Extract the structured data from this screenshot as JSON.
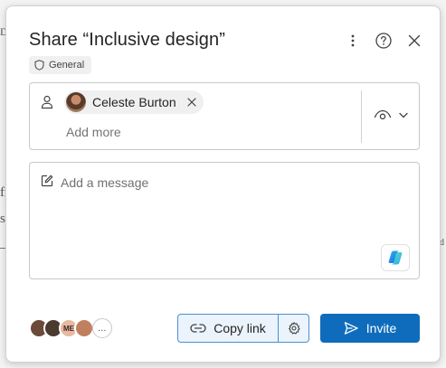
{
  "background": {
    "glyphs": [
      "D",
      "fi",
      "s",
      "d"
    ]
  },
  "dialog": {
    "title": "Share “Inclusive design”",
    "sensitivity_label": "General",
    "icons": {
      "more": "more-vertical-icon",
      "help": "help-icon",
      "close": "close-icon"
    }
  },
  "recipients": {
    "people": [
      {
        "name": "Celeste Burton"
      }
    ],
    "add_more_placeholder": "Add more",
    "permission_icon": "eye-icon"
  },
  "message": {
    "placeholder": "Add a message",
    "copilot_icon": "copilot-icon"
  },
  "footer": {
    "shared_with": [
      {
        "initials": "",
        "color": "#6b4a3a"
      },
      {
        "initials": "",
        "color": "#4a3a30"
      },
      {
        "initials": "ME",
        "color": "#e8b8a0"
      },
      {
        "initials": "",
        "color": "#c08060"
      }
    ],
    "more_label": "…",
    "copy_link_label": "Copy link",
    "invite_label": "Invite"
  },
  "colors": {
    "accent": "#0f6cbd",
    "copy_link_bg": "#ebf3fc",
    "copy_link_border": "#4b8fcc"
  }
}
